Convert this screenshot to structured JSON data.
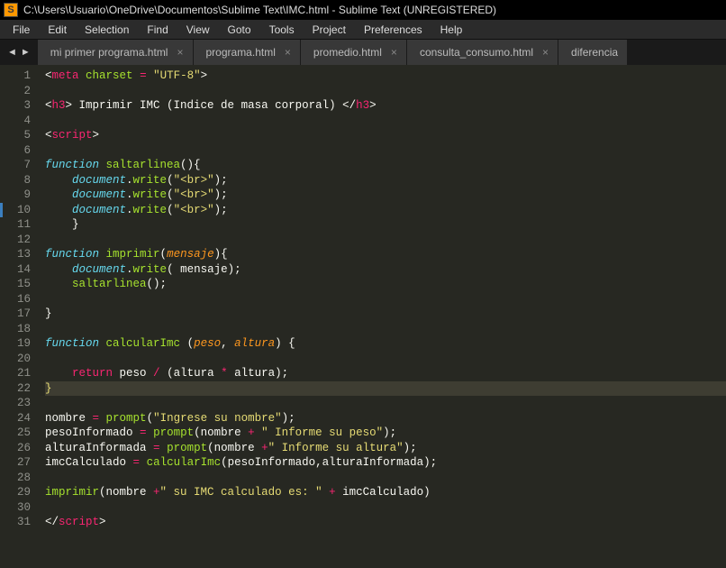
{
  "window": {
    "title": "C:\\Users\\Usuario\\OneDrive\\Documentos\\Sublime Text\\IMC.html - Sublime Text (UNREGISTERED)"
  },
  "menu": {
    "items": [
      "File",
      "Edit",
      "Selection",
      "Find",
      "View",
      "Goto",
      "Tools",
      "Project",
      "Preferences",
      "Help"
    ]
  },
  "nav": {
    "back": "◄",
    "forward": "►"
  },
  "tabs": [
    {
      "label": "mi primer programa.html",
      "close": "×"
    },
    {
      "label": "programa.html",
      "close": "×"
    },
    {
      "label": "promedio.html",
      "close": "×"
    },
    {
      "label": "consulta_consumo.html",
      "close": "×"
    },
    {
      "label": "diferencia",
      "close": ""
    }
  ],
  "gutter": {
    "start": 1,
    "end": 31,
    "active": 22
  },
  "code": {
    "1": "<span class='c-punc'>&lt;</span><span class='c-tag'>meta</span> <span class='c-attr'>charset</span> <span class='c-op'>=</span> <span class='c-str'>\"UTF-8\"</span><span class='c-punc'>&gt;</span>",
    "2": "",
    "3": "<span class='c-punc'>&lt;</span><span class='c-tag'>h3</span><span class='c-punc'>&gt; Imprimir IMC (Indice de masa corporal) &lt;/</span><span class='c-tag'>h3</span><span class='c-punc'>&gt;</span>",
    "4": "",
    "5": "<span class='c-punc'>&lt;</span><span class='c-tag'>script</span><span class='c-punc'>&gt;</span>",
    "6": "",
    "7": "<span class='c-kw'>function</span> <span class='c-attr'>saltarlinea</span><span class='c-punc'>(){</span>",
    "8": "    <span class='c-var'>document</span><span class='c-punc'>.</span><span class='c-attr'>write</span><span class='c-punc'>(</span><span class='c-str'>\"&lt;br&gt;\"</span><span class='c-punc'>);</span>",
    "9": "    <span class='c-var'>document</span><span class='c-punc'>.</span><span class='c-attr'>write</span><span class='c-punc'>(</span><span class='c-str'>\"&lt;br&gt;\"</span><span class='c-punc'>);</span>",
    "10": "    <span class='c-var'>document</span><span class='c-punc'>.</span><span class='c-attr'>write</span><span class='c-punc'>(</span><span class='c-str'>\"&lt;br&gt;\"</span><span class='c-punc'>);</span>",
    "11": "    <span class='c-punc'>}</span>",
    "12": "",
    "13": "<span class='c-kw'>function</span> <span class='c-attr'>imprimir</span><span class='c-punc'>(</span><span class='c-param'>mensaje</span><span class='c-punc'>){</span>",
    "14": "    <span class='c-var'>document</span><span class='c-punc'>.</span><span class='c-attr'>write</span><span class='c-punc'>( mensaje);</span>",
    "15": "    <span class='c-attr'>saltarlinea</span><span class='c-punc'>();</span>",
    "16": "",
    "17": "<span class='c-punc'>}</span>",
    "18": "",
    "19": "<span class='c-kw'>function</span> <span class='c-attr'>calcularImc</span> <span class='c-punc'>(</span><span class='c-param'>peso</span><span class='c-punc'>, </span><span class='c-param'>altura</span><span class='c-punc'>) {</span>",
    "20": "",
    "21": "    <span class='c-ret'>return</span><span class='c-punc'> peso </span><span class='c-op'>/</span><span class='c-punc'> (altura </span><span class='c-op'>*</span><span class='c-punc'> altura);</span>",
    "22": "<span class='c-bracket'>}</span>",
    "23": "",
    "24": "<span class='c-punc'>nombre </span><span class='c-op'>=</span><span class='c-punc'> </span><span class='c-attr'>prompt</span><span class='c-punc'>(</span><span class='c-str'>\"Ingrese su nombre\"</span><span class='c-punc'>);</span>",
    "25": "<span class='c-punc'>pesoInformado </span><span class='c-op'>=</span><span class='c-punc'> </span><span class='c-attr'>prompt</span><span class='c-punc'>(nombre </span><span class='c-op'>+</span><span class='c-punc'> </span><span class='c-str'>\" Informe su peso\"</span><span class='c-punc'>);</span>",
    "26": "<span class='c-punc'>alturaInformada </span><span class='c-op'>=</span><span class='c-punc'> </span><span class='c-attr'>prompt</span><span class='c-punc'>(nombre </span><span class='c-op'>+</span><span class='c-str'>\" Informe su altura\"</span><span class='c-punc'>);</span>",
    "27": "<span class='c-punc'>imcCalculado </span><span class='c-op'>=</span><span class='c-punc'> </span><span class='c-attr'>calcularImc</span><span class='c-punc'>(pesoInformado,alturaInformada);</span>",
    "28": "",
    "29": "<span class='c-attr'>imprimir</span><span class='c-punc'>(nombre </span><span class='c-op'>+</span><span class='c-str'>\" su IMC calculado es: \"</span><span class='c-punc'> </span><span class='c-op'>+</span><span class='c-punc'> imcCalculado)</span>",
    "30": "",
    "31": "<span class='c-punc'>&lt;/</span><span class='c-tag'>script</span><span class='c-punc'>&gt;</span>"
  }
}
